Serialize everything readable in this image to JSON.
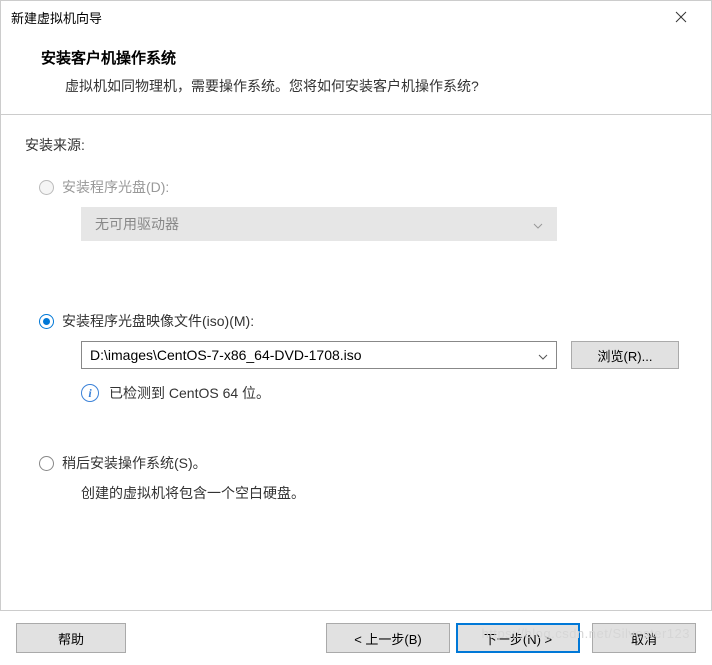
{
  "titlebar": {
    "title": "新建虚拟机向导"
  },
  "header": {
    "title": "安装客户机操作系统",
    "subtitle": "虚拟机如同物理机，需要操作系统。您将如何安装客户机操作系统?"
  },
  "content": {
    "sourceLabel": "安装来源:",
    "optionDisc": {
      "label": "安装程序光盘(D):",
      "comboText": "无可用驱动器"
    },
    "optionIso": {
      "label": "安装程序光盘映像文件(iso)(M):",
      "path": "D:\\images\\CentOS-7-x86_64-DVD-1708.iso",
      "browseLabel": "浏览(R)...",
      "infoText": "已检测到 CentOS 64 位。"
    },
    "optionLater": {
      "label": "稍后安装操作系统(S)。",
      "desc": "创建的虚拟机将包含一个空白硬盘。"
    }
  },
  "footer": {
    "help": "帮助",
    "back": "< 上一步(B)",
    "next": "下一步(N) >",
    "cancel": "取消"
  },
  "watermark": "https://blog.csdn.net/Silvester123"
}
